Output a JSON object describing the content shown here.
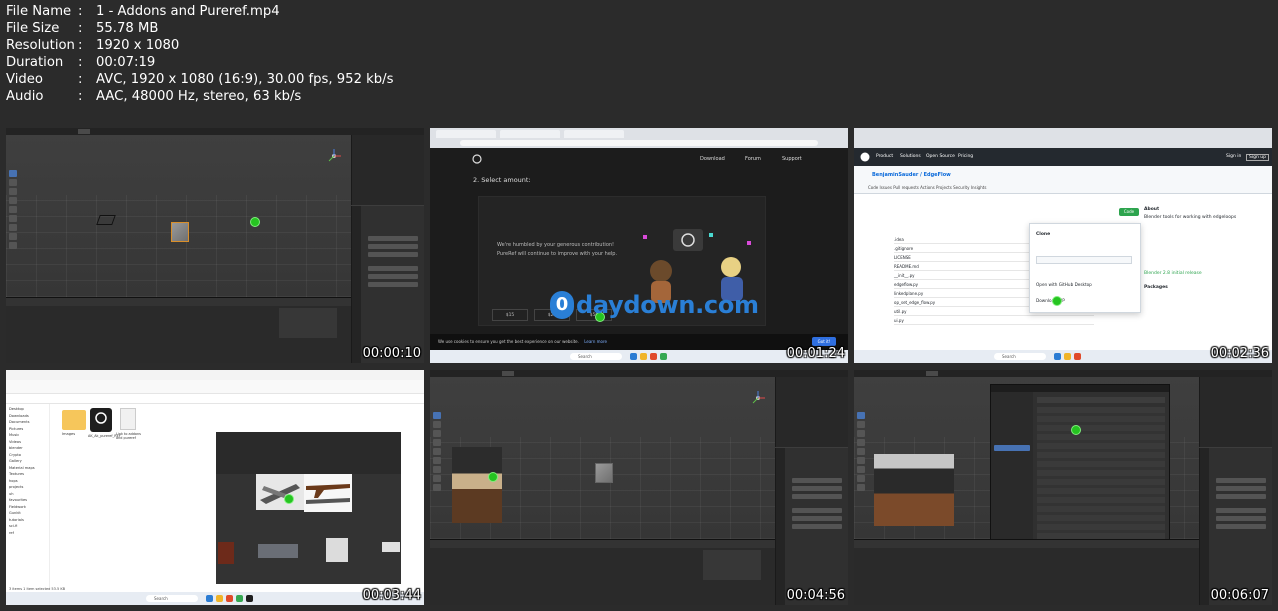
{
  "info": [
    {
      "label": "File Name",
      "value": "1 - Addons and Pureref.mp4"
    },
    {
      "label": "File Size",
      "value": "55.78 MB"
    },
    {
      "label": "Resolution",
      "value": "1920 x 1080"
    },
    {
      "label": "Duration",
      "value": "00:07:19"
    },
    {
      "label": "Video",
      "value": "AVC, 1920 x 1080 (16:9), 30.00 fps, 952 kb/s"
    },
    {
      "label": "Audio",
      "value": "AAC, 48000 Hz, stereo, 63 kb/s"
    }
  ],
  "separator": ":",
  "thumbnails": [
    {
      "timestamp": "00:00:10"
    },
    {
      "timestamp": "00:01:24"
    },
    {
      "timestamp": "00:02:36"
    },
    {
      "timestamp": "00:03:44"
    },
    {
      "timestamp": "00:04:56"
    },
    {
      "timestamp": "00:06:07"
    }
  ],
  "pureref_page": {
    "nav": [
      "Download",
      "Forum",
      "Support"
    ],
    "heading": "2. Select amount:",
    "message_line1": "We're humbled by your generous contribution!",
    "message_line2": "PureRef will continue to improve with your help.",
    "cookie_text": "We use cookies to ensure you get the best experience on our website.",
    "cookie_link": "Learn more",
    "cookie_button": "Got it!",
    "amounts": [
      "$15",
      "$25",
      "$50"
    ]
  },
  "github_page": {
    "repo": "BenjaminSauder / EdgeFlow",
    "header_items": [
      "Product",
      "Solutions",
      "Open Source",
      "Pricing"
    ],
    "signin": "Sign in",
    "signup": "Sign up",
    "tabs": "Code   Issues   Pull requests   Actions   Projects   Security   Insights",
    "files": [
      ".idea",
      ".gitignore",
      "LICENSE",
      "README.md",
      "__init__.py",
      "edgeflow.py",
      "linkedplane.py",
      "op_set_edge_flow.py",
      "util.py",
      "ui.py"
    ],
    "about_title": "About",
    "about_text": "Blender tools for working with edgeloops",
    "code_button": "Code",
    "release": "Blender 2.8 initial release",
    "packages": "Packages",
    "clone": "Clone",
    "download_zip": "Download ZIP",
    "open_desktop": "Open with GitHub Desktop"
  },
  "explorer_page": {
    "tree": [
      "Desktop",
      "Downloads",
      "Documents",
      "Pictures",
      "Music",
      "Videos",
      "blender",
      "Crypto",
      "Gallery",
      "Material maps",
      "Textures",
      "hops",
      "projects",
      "uh",
      "favourites",
      "Fieldwork",
      "Gunkit",
      "tutorials",
      "sci-fi",
      "ref"
    ],
    "items": [
      "Images",
      "AK_Ak_pureref_REF",
      "Link to addons and pureref"
    ],
    "status": "3 items   1 item selected  53.5 KB"
  },
  "watermark": "daydown.com",
  "watermark_o": "0",
  "colors": {
    "background": "#2b2b2b",
    "text": "#ffffff",
    "blender_bg": "#3d3d3d",
    "green_cursor": "#26c421",
    "brand_blue": "#2a7fd6"
  }
}
